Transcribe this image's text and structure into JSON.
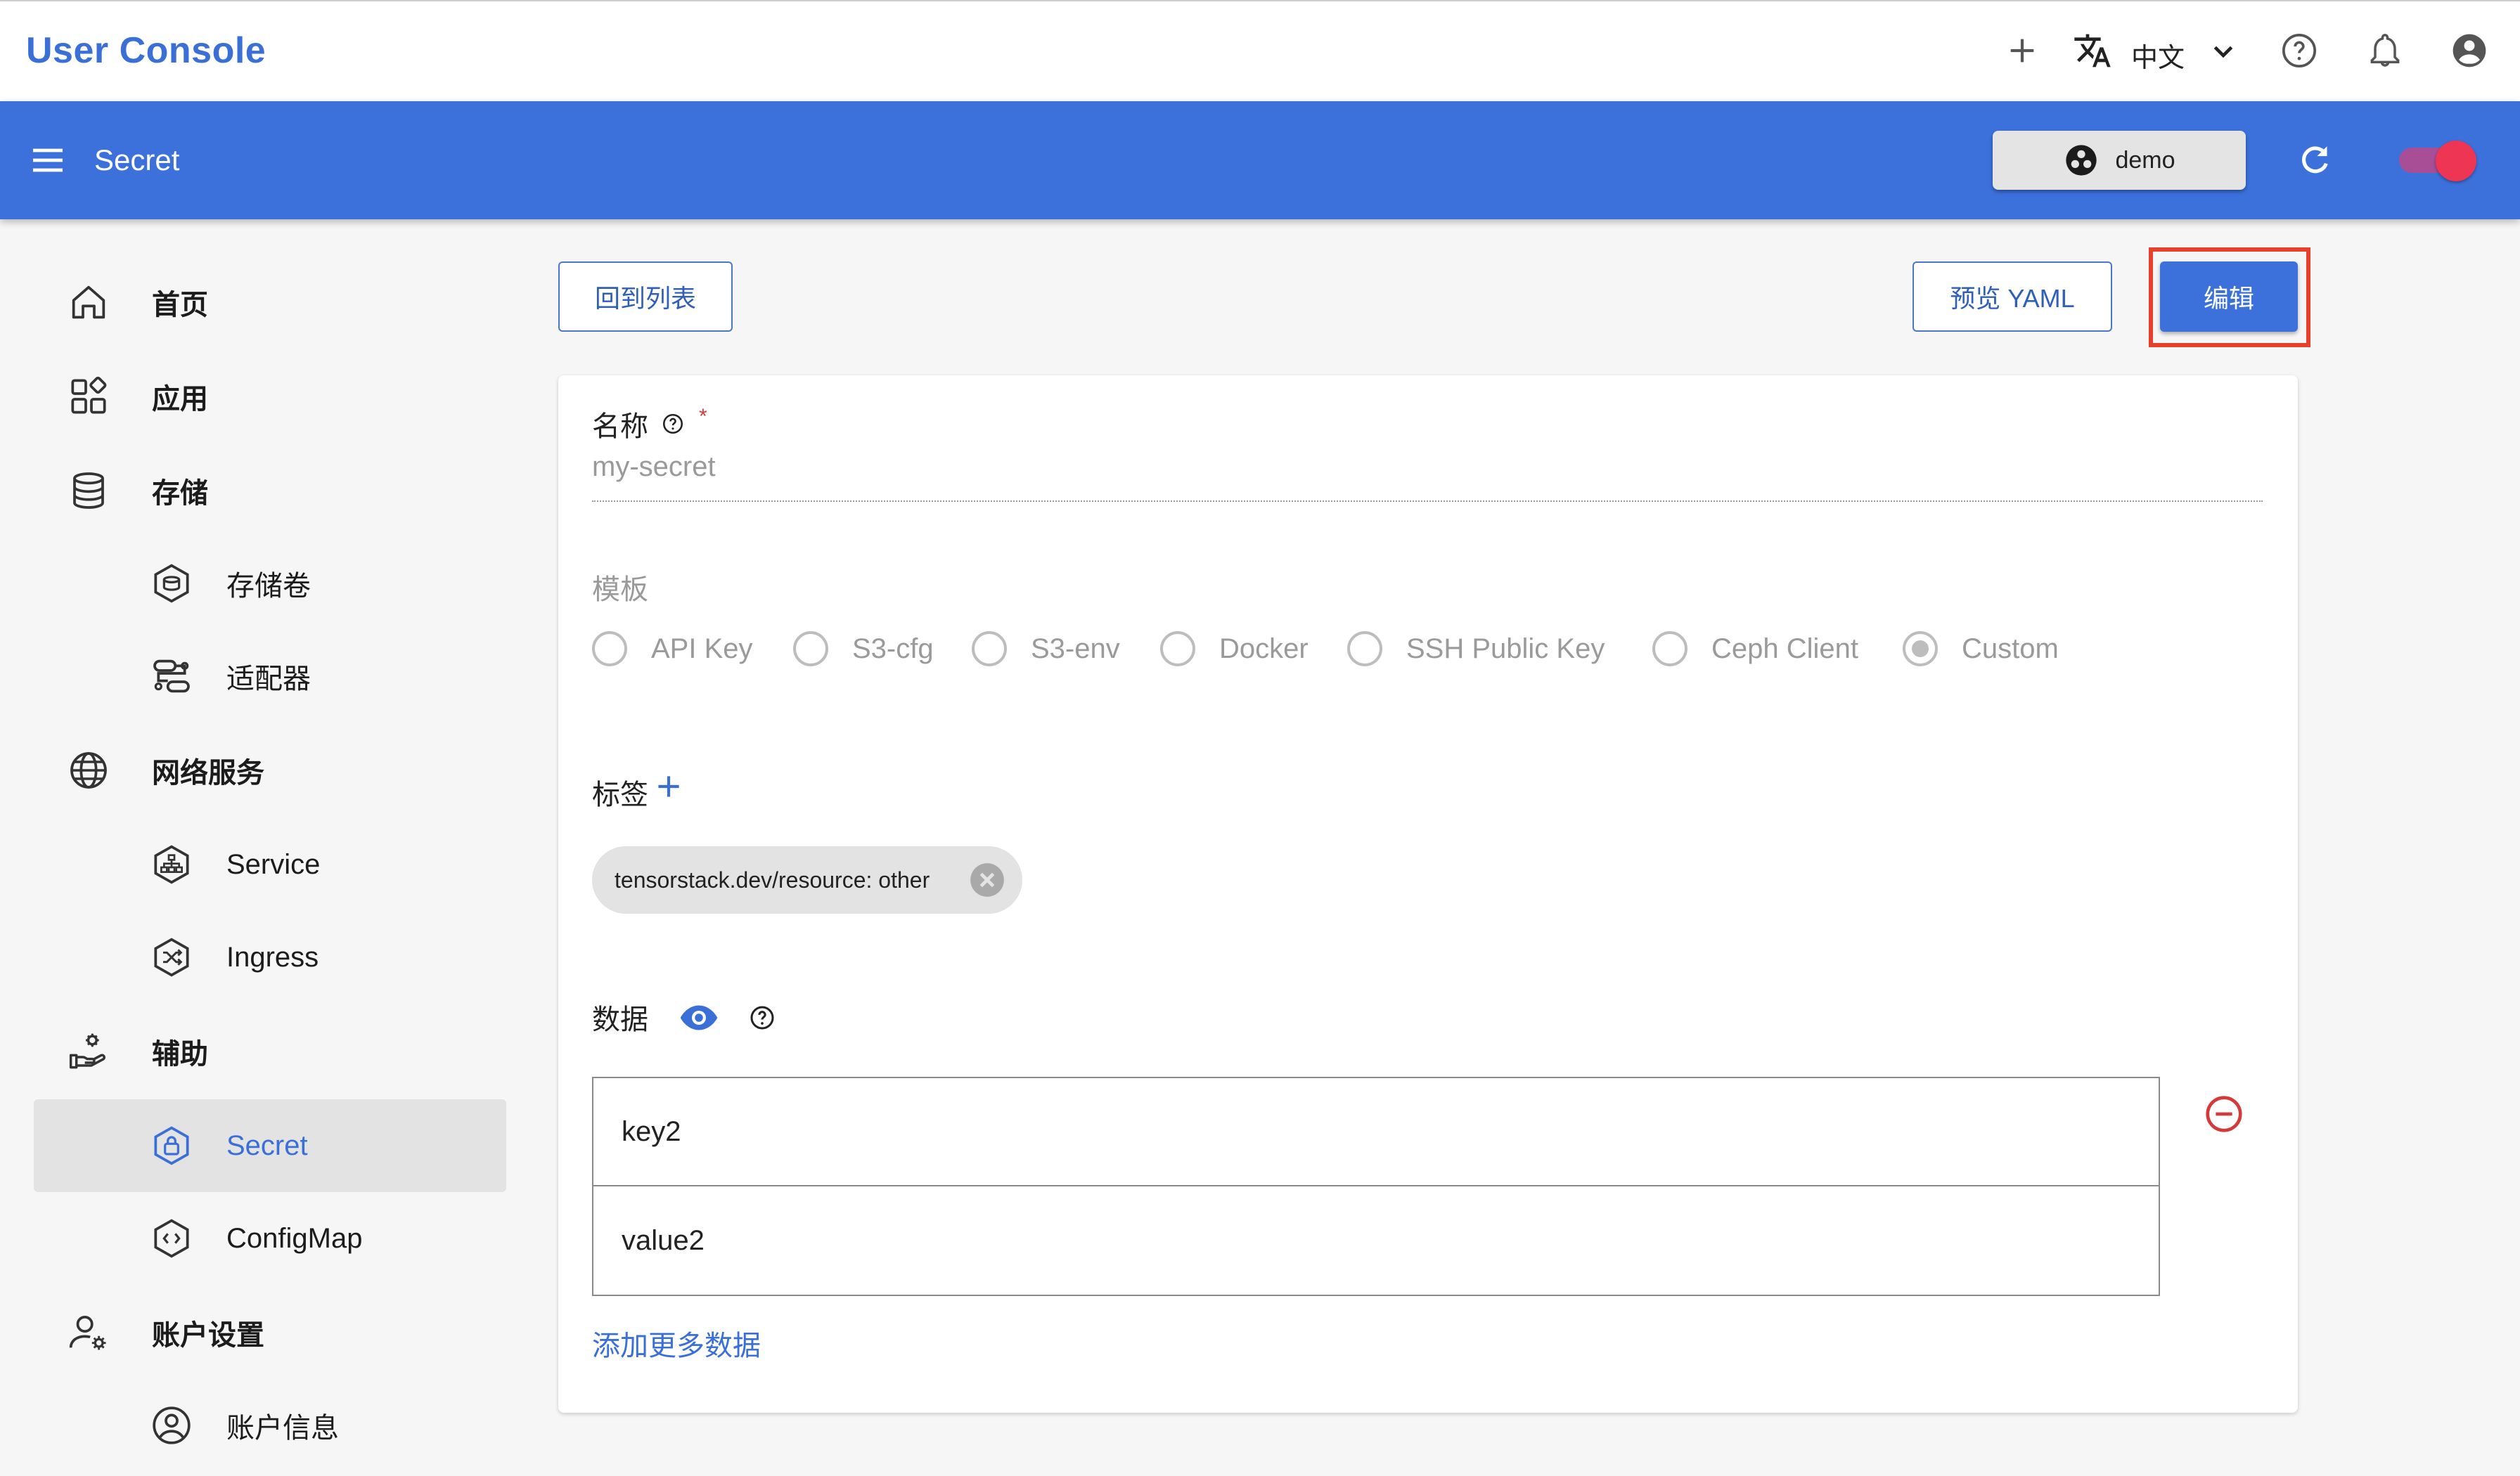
{
  "app": {
    "title": "User Console"
  },
  "topbar": {
    "add_icon": "plus-icon",
    "translate_icon": "translate-icon",
    "language": "中文",
    "language_dropdown_icon": "chevron-down-icon",
    "help_icon": "help-circle-icon",
    "notification_icon": "bell-icon",
    "account_icon": "account-circle-icon"
  },
  "header": {
    "menu_icon": "menu-icon",
    "title": "Secret",
    "namespace": "demo",
    "namespace_icon": "group-icon",
    "refresh_icon": "refresh-icon",
    "toggle_on": true
  },
  "sidebar": {
    "items": [
      {
        "label": "首页",
        "icon": "home-icon",
        "level": 0
      },
      {
        "label": "应用",
        "icon": "apps-icon",
        "level": 0
      },
      {
        "label": "存储",
        "icon": "database-icon",
        "level": 0
      },
      {
        "label": "存储卷",
        "icon": "volume-icon",
        "level": 1
      },
      {
        "label": "适配器",
        "icon": "adapter-icon",
        "level": 1
      },
      {
        "label": "网络服务",
        "icon": "globe-icon",
        "level": 0
      },
      {
        "label": "Service",
        "icon": "service-icon",
        "level": 1
      },
      {
        "label": "Ingress",
        "icon": "ingress-icon",
        "level": 1
      },
      {
        "label": "辅助",
        "icon": "helper-hand-icon",
        "level": 0
      },
      {
        "label": "Secret",
        "icon": "secret-lock-icon",
        "level": 1,
        "active": true
      },
      {
        "label": "ConfigMap",
        "icon": "configmap-icon",
        "level": 1
      },
      {
        "label": "账户设置",
        "icon": "account-settings-icon",
        "level": 0
      },
      {
        "label": "账户信息",
        "icon": "account-info-icon",
        "level": 1
      }
    ]
  },
  "actions": {
    "back_label": "回到列表",
    "preview_label": "预览 YAML",
    "edit_label": "编辑"
  },
  "form": {
    "name_label": "名称",
    "name_required": "*",
    "name_value": "my-secret",
    "template_label": "模板",
    "templates": [
      "API Key",
      "S3-cfg",
      "S3-env",
      "Docker",
      "SSH Public Key",
      "Ceph Client",
      "Custom"
    ],
    "selected_template": "Custom",
    "labels_label": "标签",
    "label_chip": "tensorstack.dev/resource: other",
    "data_label": "数据",
    "data_key": "key2",
    "data_value": "value2",
    "add_more_label": "添加更多数据"
  },
  "colors": {
    "primary": "#3c71dc",
    "highlight": "#e8402b",
    "remove": "#d33a3a",
    "toggle": "#ee3553"
  }
}
